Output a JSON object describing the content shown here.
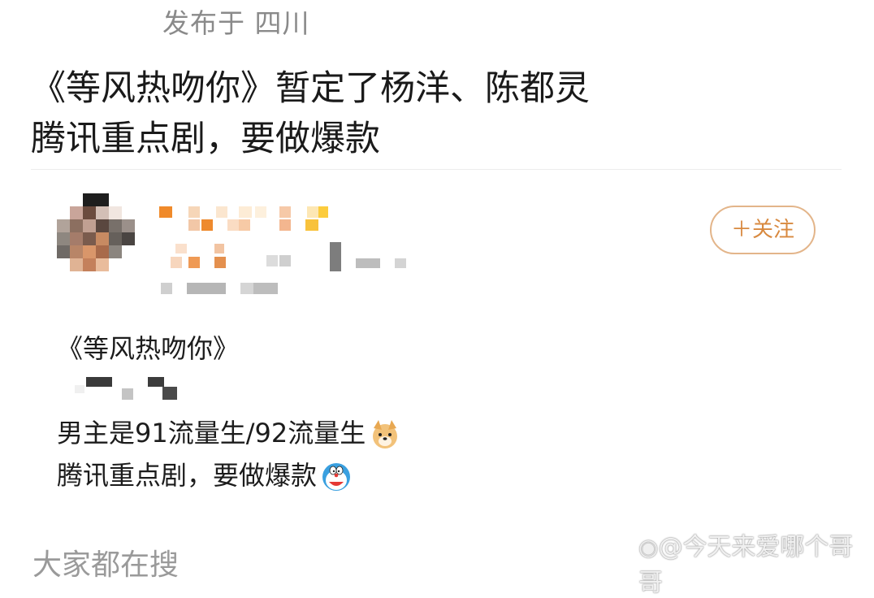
{
  "header": {
    "location": "发布于 四川"
  },
  "headline": {
    "line1": "《等风热吻你》暂定了杨洋、陈都灵",
    "line2": "腾讯重点剧，要做爆款"
  },
  "card": {
    "follow_label": "＋关注"
  },
  "post": {
    "line1": "《等风热吻你》",
    "line2": "男主是91流量生/92流量生",
    "line3": "腾讯重点剧，要做爆款"
  },
  "footer": {
    "section_label": "大家都在搜",
    "watermark": "@今天来爱哪个哥哥"
  },
  "icons": {
    "emoji1": "dog-face-icon",
    "emoji2": "doraemon-face-icon",
    "watermark": "weibo-logo-icon"
  }
}
